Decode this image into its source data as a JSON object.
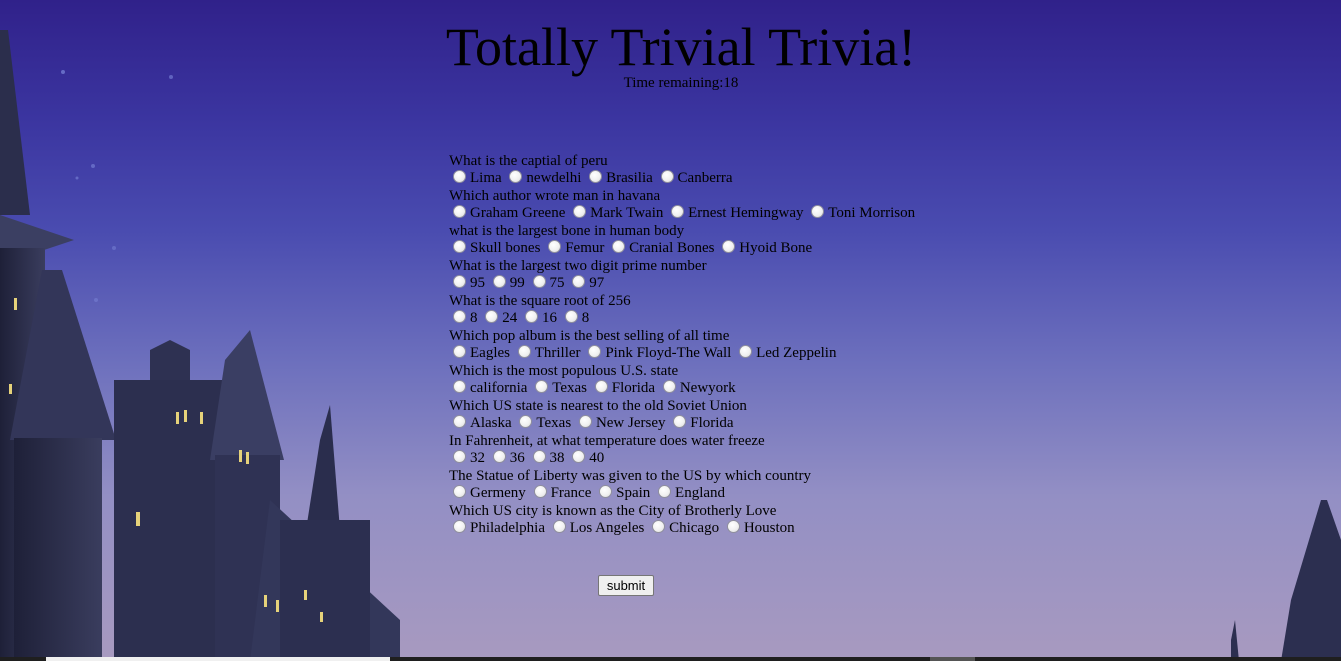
{
  "title": "Totally Trivial Trivia!",
  "timer": {
    "label": "Time remaining:",
    "value": "18"
  },
  "questions": [
    {
      "text": "What is the captial of peru",
      "options": [
        "Lima",
        "newdelhi",
        "Brasilia",
        "Canberra"
      ]
    },
    {
      "text": "Which author wrote man in havana",
      "options": [
        "Graham Greene",
        "Mark Twain",
        "Ernest Hemingway",
        "Toni Morrison"
      ]
    },
    {
      "text": "what is the largest bone in human body",
      "options": [
        "Skull bones",
        "Femur",
        "Cranial Bones",
        "Hyoid Bone"
      ]
    },
    {
      "text": "What is the largest two digit prime number",
      "options": [
        "95",
        "99",
        "75",
        "97"
      ]
    },
    {
      "text": "What is the square root of 256",
      "options": [
        "8",
        "24",
        "16",
        "8"
      ]
    },
    {
      "text": "Which pop album is the best selling of all time",
      "options": [
        "Eagles",
        "Thriller",
        "Pink Floyd-The Wall",
        "Led Zeppelin"
      ]
    },
    {
      "text": "Which is the most populous U.S. state",
      "options": [
        "california",
        "Texas",
        "Florida",
        "Newyork"
      ]
    },
    {
      "text": "Which US state is nearest to the old Soviet Union",
      "options": [
        "Alaska",
        "Texas",
        "New Jersey",
        "Florida"
      ]
    },
    {
      "text": "In Fahrenheit, at what temperature does water freeze",
      "options": [
        "32",
        "36",
        "38",
        "40"
      ]
    },
    {
      "text": "The Statue of Liberty was given to the US by which country",
      "options": [
        "Germeny",
        "France",
        "Spain",
        "England"
      ]
    },
    {
      "text": "Which US city is known as the City of Brotherly Love",
      "options": [
        "Philadelphia",
        "Los Angeles",
        "Chicago",
        "Houston"
      ]
    }
  ],
  "submit_label": "submit",
  "colors": {
    "sky_top": "#30218a",
    "sky_bottom": "#a89ac0",
    "castle": "#2a2d4a"
  }
}
